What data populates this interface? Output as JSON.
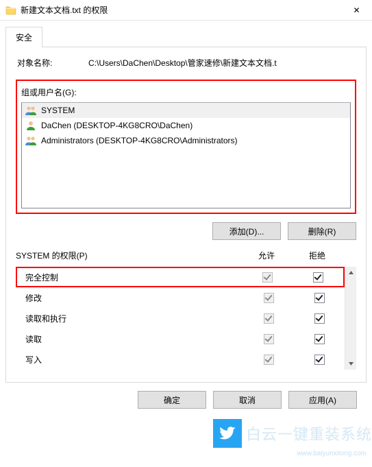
{
  "window": {
    "title": "新建文本文档.txt 的权限",
    "close_glyph": "✕"
  },
  "tab": {
    "security": "安全"
  },
  "object": {
    "label": "对象名称:",
    "value": "C:\\Users\\DaChen\\Desktop\\管家速修\\新建文本文档.t"
  },
  "group": {
    "label": "组或用户名(G):",
    "items": [
      {
        "name": "SYSTEM",
        "icon": "group"
      },
      {
        "name": "DaChen (DESKTOP-4KG8CRO\\DaChen)",
        "icon": "user"
      },
      {
        "name": "Administrators (DESKTOP-4KG8CRO\\Administrators)",
        "icon": "group"
      }
    ]
  },
  "buttons": {
    "add": "添加(D)...",
    "remove": "删除(R)"
  },
  "perm_header": {
    "label": "SYSTEM 的权限(P)",
    "allow": "允许",
    "deny": "拒绝"
  },
  "permissions": [
    {
      "name": "完全控制",
      "allow": true,
      "allow_disabled": true,
      "deny": true,
      "highlight": true
    },
    {
      "name": "修改",
      "allow": true,
      "allow_disabled": true,
      "deny": true
    },
    {
      "name": "读取和执行",
      "allow": true,
      "allow_disabled": true,
      "deny": true
    },
    {
      "name": "读取",
      "allow": true,
      "allow_disabled": true,
      "deny": true
    },
    {
      "name": "写入",
      "allow": true,
      "allow_disabled": true,
      "deny": true
    }
  ],
  "dialog_buttons": {
    "ok": "确定",
    "cancel": "取消",
    "apply": "应用(A)"
  },
  "watermark": {
    "text": "白云一键重装系统",
    "sub": "www.baiyunxitong.com"
  }
}
